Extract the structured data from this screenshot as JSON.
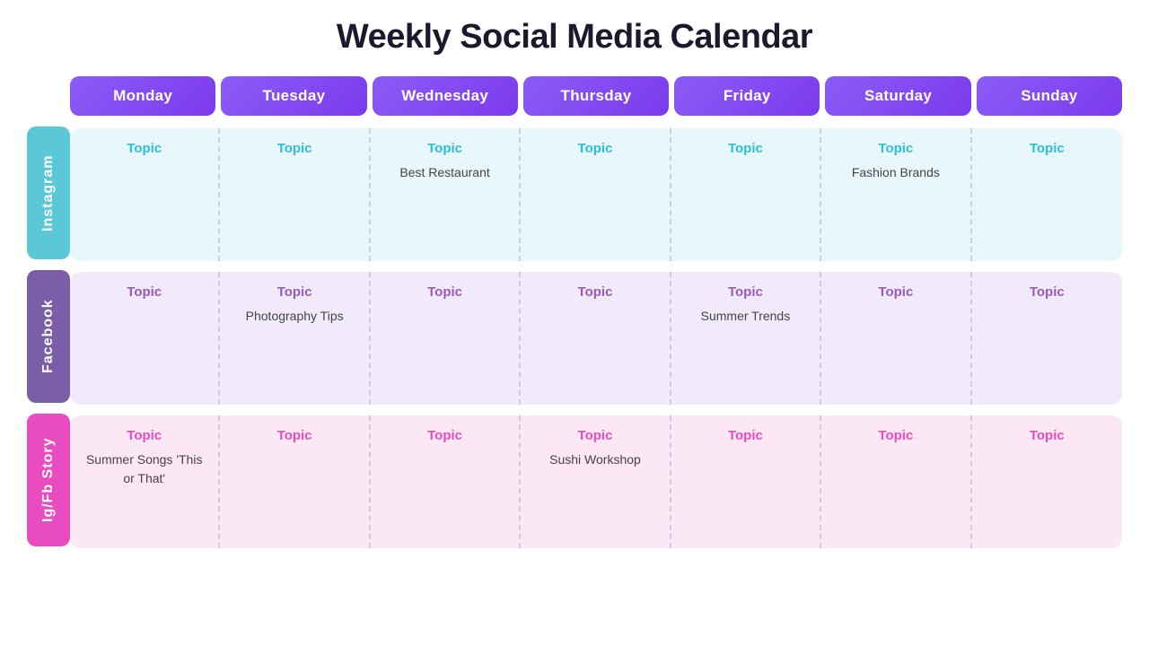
{
  "title": "Weekly Social Media Calendar",
  "days": [
    "Monday",
    "Tuesday",
    "Wednesday",
    "Thursday",
    "Friday",
    "Saturday",
    "Sunday"
  ],
  "rows": [
    {
      "label": "Instagram",
      "key": "instagram",
      "topicLabel": "Topic",
      "cells": [
        {
          "topic": "Topic",
          "content": ""
        },
        {
          "topic": "Topic",
          "content": ""
        },
        {
          "topic": "Topic",
          "content": "Best Restaurant"
        },
        {
          "topic": "Topic",
          "content": ""
        },
        {
          "topic": "Topic",
          "content": ""
        },
        {
          "topic": "Topic",
          "content": "Fashion Brands"
        },
        {
          "topic": "Topic",
          "content": ""
        }
      ]
    },
    {
      "label": "Facebook",
      "key": "facebook",
      "topicLabel": "Topic",
      "cells": [
        {
          "topic": "Topic",
          "content": ""
        },
        {
          "topic": "Topic",
          "content": "Photography Tips"
        },
        {
          "topic": "Topic",
          "content": ""
        },
        {
          "topic": "Topic",
          "content": ""
        },
        {
          "topic": "Topic",
          "content": "Summer Trends"
        },
        {
          "topic": "Topic",
          "content": ""
        },
        {
          "topic": "Topic",
          "content": ""
        }
      ]
    },
    {
      "label": "Ig/Fb Story",
      "key": "igfb",
      "topicLabel": "Topic",
      "cells": [
        {
          "topic": "Topic",
          "content": "Summer Songs\n'This or That'"
        },
        {
          "topic": "Topic",
          "content": ""
        },
        {
          "topic": "Topic",
          "content": ""
        },
        {
          "topic": "Topic",
          "content": "Sushi Workshop"
        },
        {
          "topic": "Topic",
          "content": ""
        },
        {
          "topic": "Topic",
          "content": ""
        },
        {
          "topic": "Topic",
          "content": ""
        }
      ]
    }
  ]
}
